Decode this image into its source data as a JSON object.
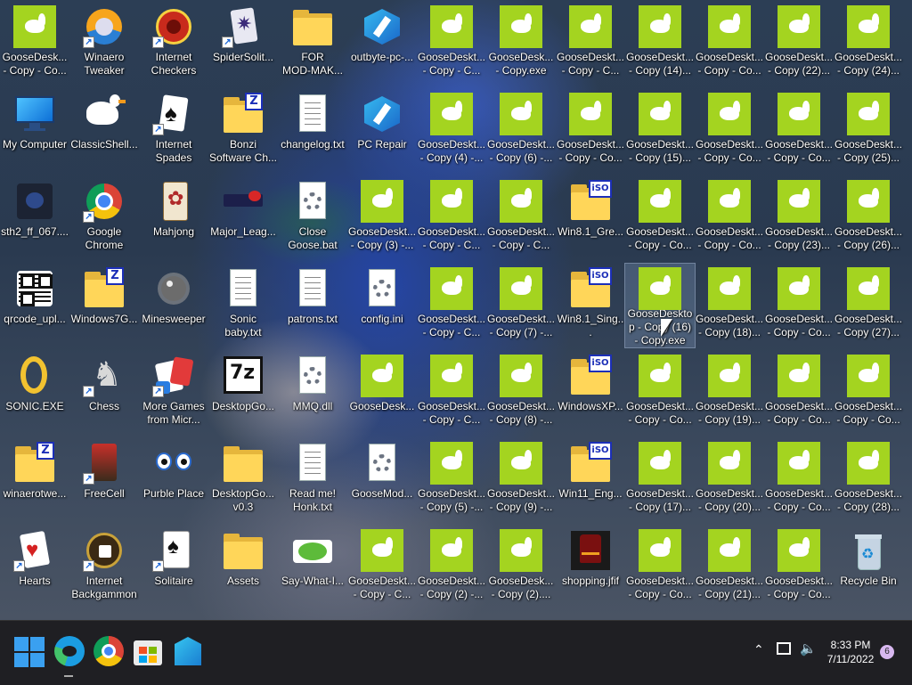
{
  "desktop": {
    "columns": [
      [
        "GooseDesk...\n- Copy - Co...",
        "My Computer",
        "sth2_ff_067....",
        "qrcode_upl...",
        "SONIC.EXE",
        "winaerotwe...",
        "Hearts"
      ],
      [
        "Winaero\nTweaker",
        "ClassicShell...",
        "Google\nChrome",
        "Windows7G...",
        "Chess",
        "FreeCell",
        "Internet\nBackgammon"
      ],
      [
        "Internet\nCheckers",
        "Internet\nSpades",
        "Mahjong",
        "Minesweeper",
        "More Games\nfrom Micr...",
        "Purble Place",
        "Solitaire"
      ],
      [
        "SpiderSolit...",
        "Bonzi\nSoftware Ch...",
        "Major_Leag...",
        "Sonic\nbaby.txt",
        "DesktopGo...",
        "DesktopGo...\nv0.3",
        "Assets"
      ],
      [
        "FOR\nMOD-MAK...",
        "changelog.txt",
        "Close\nGoose.bat",
        "patrons.txt",
        "MMQ.dll",
        "Read me!\nHonk.txt",
        "Say-What-I..."
      ],
      [
        "outbyte-pc-...",
        "PC Repair",
        "GooseDeskt...\n- Copy (3) -...",
        "config.ini",
        "GooseDesk...",
        "GooseMod...",
        "GooseDeskt...\n- Copy - C..."
      ],
      [
        "GooseDeskt...\n- Copy - C...",
        "GooseDeskt...\n- Copy (4) -...",
        "GooseDeskt...\n- Copy - C...",
        "GooseDeskt...\n- Copy - C...",
        "GooseDeskt...\n- Copy - C...",
        "GooseDeskt...\n- Copy (5) -...",
        "GooseDeskt...\n- Copy (2) -..."
      ],
      [
        "GooseDesk...\n- Copy.exe",
        "GooseDeskt...\n- Copy (6) -...",
        "GooseDeskt...\n- Copy - C...",
        "GooseDeskt...\n- Copy (7) -...",
        "GooseDeskt...\n- Copy (8) -...",
        "GooseDeskt...\n- Copy (9) -...",
        "GooseDesk...\n- Copy (2)...."
      ],
      [
        "GooseDeskt...\n- Copy - C...",
        "GooseDeskt...\n- Copy - Co...",
        "Win8.1_Gre...",
        "Win8.1_Sing...",
        "WindowsXP...",
        "Win11_Eng...",
        "shopping.jfif"
      ],
      [
        "GooseDeskt...\n- Copy (14)...",
        "GooseDeskt...\n- Copy (15)...",
        "GooseDeskt...\n- Copy - Co...",
        "GooseDeskto\np - Copy (16)\n- Copy.exe",
        "GooseDeskt...\n- Copy - Co...",
        "GooseDeskt...\n- Copy (17)...",
        "GooseDeskt...\n- Copy - Co..."
      ],
      [
        "GooseDeskt...\n- Copy - Co...",
        "GooseDeskt...\n- Copy - Co...",
        "GooseDeskt...\n- Copy - Co...",
        "GooseDeskt...\n- Copy (18)...",
        "GooseDeskt...\n- Copy (19)...",
        "GooseDeskt...\n- Copy (20)...",
        "GooseDeskt...\n- Copy (21)..."
      ],
      [
        "GooseDeskt...\n- Copy (22)...",
        "GooseDeskt...\n- Copy - Co...",
        "GooseDeskt...\n- Copy (23)...",
        "GooseDeskt...\n- Copy - Co...",
        "GooseDeskt...\n- Copy - Co...",
        "GooseDeskt...\n- Copy - Co...",
        "GooseDeskt...\n- Copy - Co..."
      ],
      [
        "GooseDeskt...\n- Copy (24)...",
        "GooseDeskt...\n- Copy (25)...",
        "GooseDeskt...\n- Copy (26)...",
        "GooseDeskt...\n- Copy (27)...",
        "GooseDeskt...\n- Copy - Co...",
        "GooseDeskt...\n- Copy (28)...",
        "Recycle Bin"
      ]
    ],
    "icon_types": [
      [
        "goose",
        "monitor",
        "dark-image",
        "qr-image",
        "ring",
        "zip-folder",
        "hearts-card"
      ],
      [
        "winaero-logo",
        "goose-sprite",
        "chrome-logo",
        "zip-folder",
        "chess-knight",
        "freecell-king",
        "backgammon"
      ],
      [
        "checkers",
        "spades-card",
        "mahjong-tile",
        "mine",
        "more-games",
        "purble-eyes",
        "solitaire-card"
      ],
      [
        "spider-card",
        "zip-folder",
        "mlg-logo",
        "text-file",
        "7z-archive",
        "folder",
        "folder"
      ],
      [
        "folder",
        "text-file",
        "bat-file",
        "text-file",
        "dll-file",
        "text-file",
        "say-what-logo"
      ],
      [
        "outbyte-logo",
        "outbyte-logo",
        "goose",
        "ini-file",
        "goose",
        "settings-file",
        "goose"
      ],
      [
        "goose",
        "goose",
        "goose",
        "goose",
        "goose",
        "goose",
        "goose"
      ],
      [
        "goose",
        "goose",
        "goose",
        "goose",
        "goose",
        "goose",
        "goose"
      ],
      [
        "goose",
        "goose",
        "iso-folder",
        "iso-folder",
        "iso-folder",
        "iso-folder",
        "shopping-image"
      ],
      [
        "goose",
        "goose",
        "goose",
        "goose",
        "goose",
        "goose",
        "goose"
      ],
      [
        "goose",
        "goose",
        "goose",
        "goose",
        "goose",
        "goose",
        "goose"
      ],
      [
        "goose",
        "goose",
        "goose",
        "goose",
        "goose",
        "goose",
        "goose"
      ],
      [
        "goose",
        "goose",
        "goose",
        "goose",
        "goose",
        "goose",
        "recycle-bin"
      ]
    ],
    "selected_icon": "GooseDeskto\np - Copy (16)\n- Copy.exe"
  },
  "taskbar": {
    "pinned": [
      "start-icon",
      "edge-icon",
      "chrome-icon",
      "store-icon",
      "azure-icon"
    ],
    "tray_icons": [
      "chevron-up-icon",
      "network-icon",
      "volume-icon"
    ],
    "time": "8:33 PM",
    "date": "7/11/2022",
    "notification_count": "6"
  },
  "colors": {
    "goose_green": "#a4d420",
    "taskbar_bg": "#1f1f23",
    "folder_yellow": "#ffd659"
  }
}
